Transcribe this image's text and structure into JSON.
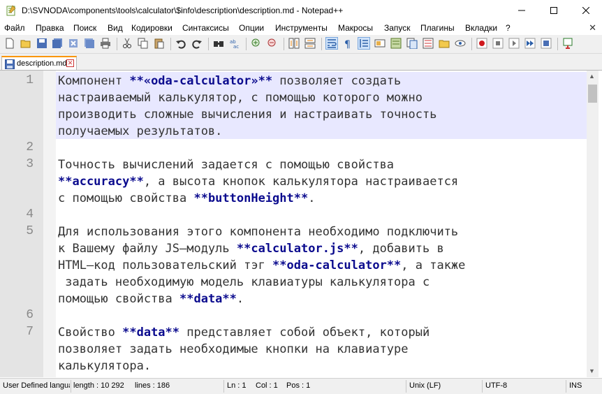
{
  "window": {
    "title": "D:\\SVNODA\\components\\tools\\calculator\\$info\\description\\description.md - Notepad++",
    "minimize_icon": "minimize-icon",
    "maximize_icon": "maximize-icon",
    "close_icon": "close-icon"
  },
  "menu": [
    "Файл",
    "Правка",
    "Поиск",
    "Вид",
    "Кодировки",
    "Синтаксисы",
    "Опции",
    "Инструменты",
    "Макросы",
    "Запуск",
    "Плагины",
    "Вкладки",
    "?"
  ],
  "menu_close": "✕",
  "tab": {
    "label": "description.md",
    "close": "✕"
  },
  "lines": {
    "n1": "1",
    "n2": "2",
    "n3": "3",
    "n4": "4",
    "n5": "5",
    "n6": "6",
    "n7": "7",
    "l1a": "Компонент ",
    "l1b": "**«oda-calculator»**",
    "l1c": " позволяет создать",
    "l1d": "настраиваемый калькулятор, с помощью которого можно",
    "l1e": "производить сложные вычисления и настраивать точность",
    "l1f": "получаемых результатов.",
    "l3a": "Точность вычислений задается с помощью свойства",
    "l3b": "**accuracy**",
    "l3c": ", а высота кнопок калькулятора настраивается",
    "l3d": "с помощью свойства ",
    "l3e": "**buttonHeight**",
    "l3f": ".",
    "l5a": "Для использования этого компонента необходимо подключить",
    "l5b": "к Вашему файлу JS–модуль ",
    "l5c": "**calculator.js**",
    "l5d": ", добавить в",
    "l5e": "HTML–код пользовательский тэг ",
    "l5f": "**oda-calculator**",
    "l5g": ", а также",
    "l5h": " задать необходимую модель клавиатуры калькулятора с",
    "l5i": "помощью свойства ",
    "l5j": "**data**",
    "l5k": ".",
    "l7a": "Свойство ",
    "l7b": "**data**",
    "l7c": " представляет собой объект, который",
    "l7d": "позволяет задать необходимые кнопки на клавиатуре",
    "l7e": "калькулятора."
  },
  "status": {
    "lang": "User Defined language file - Markdown",
    "length": "length : 10 292",
    "lines": "lines : 186",
    "ln": "Ln : 1",
    "col": "Col : 1",
    "pos": "Pos : 1",
    "eol": "Unix (LF)",
    "enc": "UTF-8",
    "ins": "INS"
  },
  "colors": {
    "accent_tab": "#fa9600",
    "bold_text": "#0b0b8e",
    "line_highlight": "#e8e8ff"
  }
}
